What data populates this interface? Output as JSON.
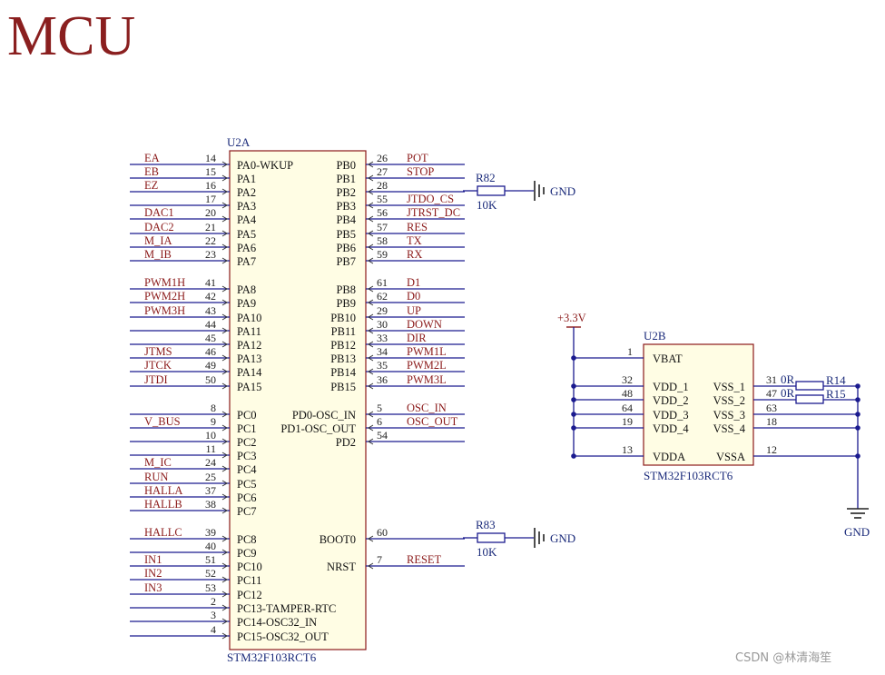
{
  "title": "MCU",
  "watermark": "CSDN @林清海笙",
  "colors": {
    "wire": "#1b1b8f",
    "net": "#8b1a1a",
    "chip_border": "#8b1a1a",
    "chip_fill": "#fffde4",
    "title": "#8a1f1f"
  },
  "u2a": {
    "ref": "U2A",
    "part": "STM32F103RCT6",
    "left_pins": [
      {
        "num": "14",
        "name": "PA0-WKUP",
        "net": "EA"
      },
      {
        "num": "15",
        "name": "PA1",
        "net": "EB"
      },
      {
        "num": "16",
        "name": "PA2",
        "net": "EZ"
      },
      {
        "num": "17",
        "name": "PA3",
        "net": ""
      },
      {
        "num": "20",
        "name": "PA4",
        "net": "DAC1"
      },
      {
        "num": "21",
        "name": "PA5",
        "net": "DAC2"
      },
      {
        "num": "22",
        "name": "PA6",
        "net": "M_IA"
      },
      {
        "num": "23",
        "name": "PA7",
        "net": "M_IB"
      },
      {
        "num": "41",
        "name": "PA8",
        "net": "PWM1H"
      },
      {
        "num": "42",
        "name": "PA9",
        "net": "PWM2H"
      },
      {
        "num": "43",
        "name": "PA10",
        "net": "PWM3H"
      },
      {
        "num": "44",
        "name": "PA11",
        "net": ""
      },
      {
        "num": "45",
        "name": "PA12",
        "net": ""
      },
      {
        "num": "46",
        "name": "PA13",
        "net": "JTMS"
      },
      {
        "num": "49",
        "name": "PA14",
        "net": "JTCK"
      },
      {
        "num": "50",
        "name": "PA15",
        "net": "JTDI"
      },
      {
        "num": "8",
        "name": "PC0",
        "net": ""
      },
      {
        "num": "9",
        "name": "PC1",
        "net": "V_BUS"
      },
      {
        "num": "10",
        "name": "PC2",
        "net": ""
      },
      {
        "num": "11",
        "name": "PC3",
        "net": ""
      },
      {
        "num": "24",
        "name": "PC4",
        "net": "M_IC"
      },
      {
        "num": "25",
        "name": "PC5",
        "net": "RUN"
      },
      {
        "num": "37",
        "name": "PC6",
        "net": "HALLA"
      },
      {
        "num": "38",
        "name": "PC7",
        "net": "HALLB"
      },
      {
        "num": "39",
        "name": "PC8",
        "net": "HALLC"
      },
      {
        "num": "40",
        "name": "PC9",
        "net": ""
      },
      {
        "num": "51",
        "name": "PC10",
        "net": "IN1"
      },
      {
        "num": "52",
        "name": "PC11",
        "net": "IN2"
      },
      {
        "num": "53",
        "name": "PC12",
        "net": "IN3"
      },
      {
        "num": "2",
        "name": "PC13-TAMPER-RTC",
        "net": ""
      },
      {
        "num": "3",
        "name": "PC14-OSC32_IN",
        "net": ""
      },
      {
        "num": "4",
        "name": "PC15-OSC32_OUT",
        "net": ""
      }
    ],
    "right_pins": [
      {
        "num": "26",
        "name": "PB0",
        "net": "POT"
      },
      {
        "num": "27",
        "name": "PB1",
        "net": "STOP"
      },
      {
        "num": "28",
        "name": "PB2",
        "net": ""
      },
      {
        "num": "55",
        "name": "PB3",
        "net": "JTDO_CS"
      },
      {
        "num": "56",
        "name": "PB4",
        "net": "JTRST_DC"
      },
      {
        "num": "57",
        "name": "PB5",
        "net": "RES"
      },
      {
        "num": "58",
        "name": "PB6",
        "net": "TX"
      },
      {
        "num": "59",
        "name": "PB7",
        "net": "RX"
      },
      {
        "num": "61",
        "name": "PB8",
        "net": "D1"
      },
      {
        "num": "62",
        "name": "PB9",
        "net": "D0"
      },
      {
        "num": "29",
        "name": "PB10",
        "net": "UP"
      },
      {
        "num": "30",
        "name": "PB11",
        "net": "DOWN"
      },
      {
        "num": "33",
        "name": "PB12",
        "net": "DIR"
      },
      {
        "num": "34",
        "name": "PB13",
        "net": "PWM1L"
      },
      {
        "num": "35",
        "name": "PB14",
        "net": "PWM2L"
      },
      {
        "num": "36",
        "name": "PB15",
        "net": "PWM3L"
      },
      {
        "num": "5",
        "name": "PD0-OSC_IN",
        "net": "OSC_IN"
      },
      {
        "num": "6",
        "name": "PD1-OSC_OUT",
        "net": "OSC_OUT"
      },
      {
        "num": "54",
        "name": "PD2",
        "net": ""
      },
      {
        "num": "60",
        "name": "BOOT0",
        "net": ""
      },
      {
        "num": "7",
        "name": "NRST",
        "net": "RESET"
      }
    ],
    "r82": {
      "ref": "R82",
      "value": "10K",
      "gnd": "GND"
    },
    "r83": {
      "ref": "R83",
      "value": "10K",
      "gnd": "GND"
    }
  },
  "u2b": {
    "ref": "U2B",
    "part": "STM32F103RCT6",
    "power": "+3.3V",
    "gnd": "GND",
    "left_pins": [
      {
        "num": "1",
        "name": "VBAT"
      },
      {
        "num": "32",
        "name": "VDD_1"
      },
      {
        "num": "48",
        "name": "VDD_2"
      },
      {
        "num": "64",
        "name": "VDD_3"
      },
      {
        "num": "19",
        "name": "VDD_4"
      },
      {
        "num": "13",
        "name": "VDDA"
      }
    ],
    "right_pins": [
      {
        "num": "31",
        "name": "VSS_1"
      },
      {
        "num": "47",
        "name": "VSS_2"
      },
      {
        "num": "63",
        "name": "VSS_3"
      },
      {
        "num": "18",
        "name": "VSS_4"
      },
      {
        "num": "12",
        "name": "VSSA"
      }
    ],
    "r14": {
      "ref": "R14",
      "value": "0R"
    },
    "r15": {
      "ref": "R15",
      "value": "0R"
    }
  }
}
